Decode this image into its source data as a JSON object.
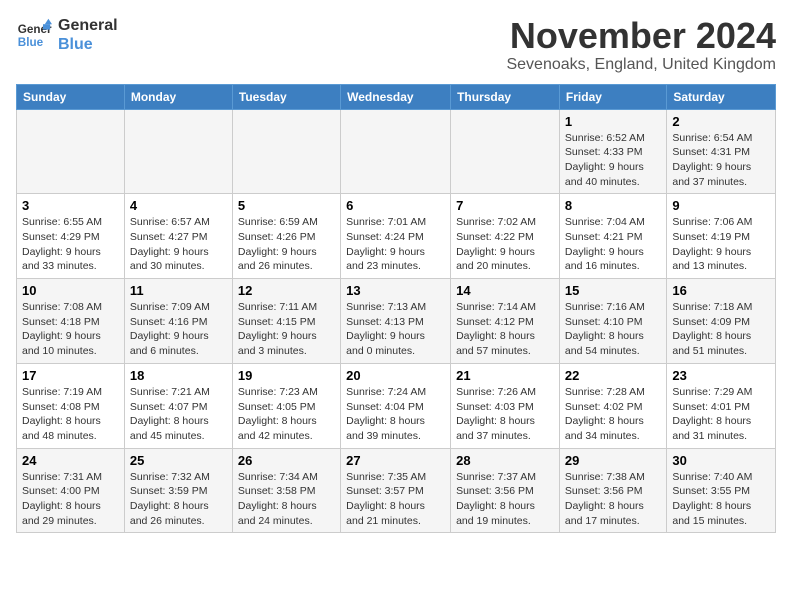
{
  "header": {
    "logo_line1": "General",
    "logo_line2": "Blue",
    "month": "November 2024",
    "location": "Sevenoaks, England, United Kingdom"
  },
  "days_of_week": [
    "Sunday",
    "Monday",
    "Tuesday",
    "Wednesday",
    "Thursday",
    "Friday",
    "Saturday"
  ],
  "weeks": [
    [
      {
        "day": "",
        "info": ""
      },
      {
        "day": "",
        "info": ""
      },
      {
        "day": "",
        "info": ""
      },
      {
        "day": "",
        "info": ""
      },
      {
        "day": "",
        "info": ""
      },
      {
        "day": "1",
        "info": "Sunrise: 6:52 AM\nSunset: 4:33 PM\nDaylight: 9 hours and 40 minutes."
      },
      {
        "day": "2",
        "info": "Sunrise: 6:54 AM\nSunset: 4:31 PM\nDaylight: 9 hours and 37 minutes."
      }
    ],
    [
      {
        "day": "3",
        "info": "Sunrise: 6:55 AM\nSunset: 4:29 PM\nDaylight: 9 hours and 33 minutes."
      },
      {
        "day": "4",
        "info": "Sunrise: 6:57 AM\nSunset: 4:27 PM\nDaylight: 9 hours and 30 minutes."
      },
      {
        "day": "5",
        "info": "Sunrise: 6:59 AM\nSunset: 4:26 PM\nDaylight: 9 hours and 26 minutes."
      },
      {
        "day": "6",
        "info": "Sunrise: 7:01 AM\nSunset: 4:24 PM\nDaylight: 9 hours and 23 minutes."
      },
      {
        "day": "7",
        "info": "Sunrise: 7:02 AM\nSunset: 4:22 PM\nDaylight: 9 hours and 20 minutes."
      },
      {
        "day": "8",
        "info": "Sunrise: 7:04 AM\nSunset: 4:21 PM\nDaylight: 9 hours and 16 minutes."
      },
      {
        "day": "9",
        "info": "Sunrise: 7:06 AM\nSunset: 4:19 PM\nDaylight: 9 hours and 13 minutes."
      }
    ],
    [
      {
        "day": "10",
        "info": "Sunrise: 7:08 AM\nSunset: 4:18 PM\nDaylight: 9 hours and 10 minutes."
      },
      {
        "day": "11",
        "info": "Sunrise: 7:09 AM\nSunset: 4:16 PM\nDaylight: 9 hours and 6 minutes."
      },
      {
        "day": "12",
        "info": "Sunrise: 7:11 AM\nSunset: 4:15 PM\nDaylight: 9 hours and 3 minutes."
      },
      {
        "day": "13",
        "info": "Sunrise: 7:13 AM\nSunset: 4:13 PM\nDaylight: 9 hours and 0 minutes."
      },
      {
        "day": "14",
        "info": "Sunrise: 7:14 AM\nSunset: 4:12 PM\nDaylight: 8 hours and 57 minutes."
      },
      {
        "day": "15",
        "info": "Sunrise: 7:16 AM\nSunset: 4:10 PM\nDaylight: 8 hours and 54 minutes."
      },
      {
        "day": "16",
        "info": "Sunrise: 7:18 AM\nSunset: 4:09 PM\nDaylight: 8 hours and 51 minutes."
      }
    ],
    [
      {
        "day": "17",
        "info": "Sunrise: 7:19 AM\nSunset: 4:08 PM\nDaylight: 8 hours and 48 minutes."
      },
      {
        "day": "18",
        "info": "Sunrise: 7:21 AM\nSunset: 4:07 PM\nDaylight: 8 hours and 45 minutes."
      },
      {
        "day": "19",
        "info": "Sunrise: 7:23 AM\nSunset: 4:05 PM\nDaylight: 8 hours and 42 minutes."
      },
      {
        "day": "20",
        "info": "Sunrise: 7:24 AM\nSunset: 4:04 PM\nDaylight: 8 hours and 39 minutes."
      },
      {
        "day": "21",
        "info": "Sunrise: 7:26 AM\nSunset: 4:03 PM\nDaylight: 8 hours and 37 minutes."
      },
      {
        "day": "22",
        "info": "Sunrise: 7:28 AM\nSunset: 4:02 PM\nDaylight: 8 hours and 34 minutes."
      },
      {
        "day": "23",
        "info": "Sunrise: 7:29 AM\nSunset: 4:01 PM\nDaylight: 8 hours and 31 minutes."
      }
    ],
    [
      {
        "day": "24",
        "info": "Sunrise: 7:31 AM\nSunset: 4:00 PM\nDaylight: 8 hours and 29 minutes."
      },
      {
        "day": "25",
        "info": "Sunrise: 7:32 AM\nSunset: 3:59 PM\nDaylight: 8 hours and 26 minutes."
      },
      {
        "day": "26",
        "info": "Sunrise: 7:34 AM\nSunset: 3:58 PM\nDaylight: 8 hours and 24 minutes."
      },
      {
        "day": "27",
        "info": "Sunrise: 7:35 AM\nSunset: 3:57 PM\nDaylight: 8 hours and 21 minutes."
      },
      {
        "day": "28",
        "info": "Sunrise: 7:37 AM\nSunset: 3:56 PM\nDaylight: 8 hours and 19 minutes."
      },
      {
        "day": "29",
        "info": "Sunrise: 7:38 AM\nSunset: 3:56 PM\nDaylight: 8 hours and 17 minutes."
      },
      {
        "day": "30",
        "info": "Sunrise: 7:40 AM\nSunset: 3:55 PM\nDaylight: 8 hours and 15 minutes."
      }
    ]
  ]
}
